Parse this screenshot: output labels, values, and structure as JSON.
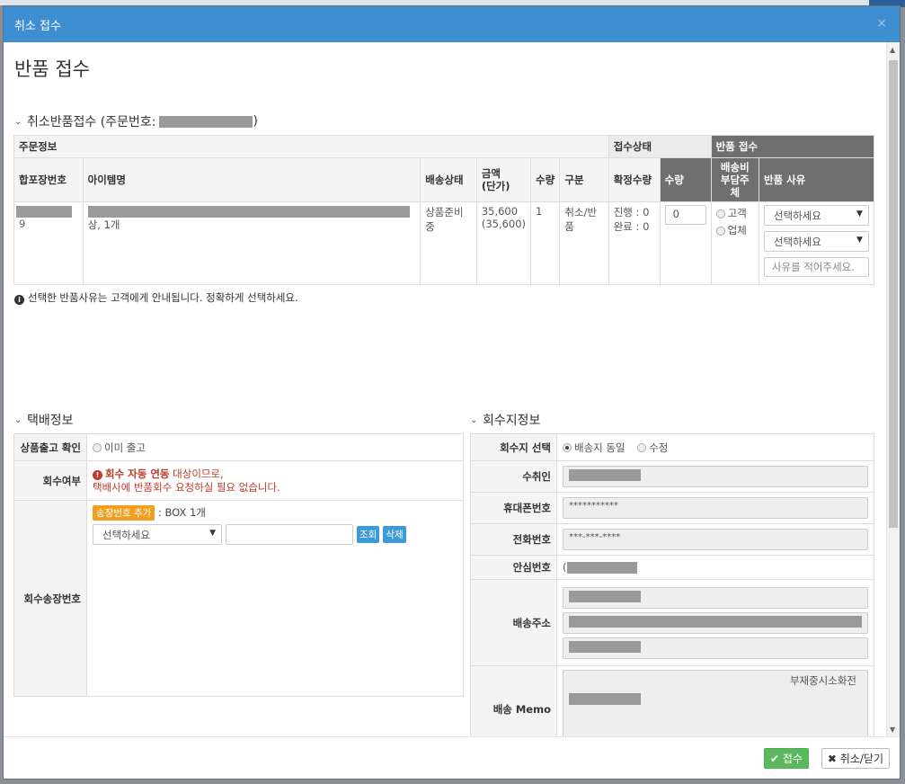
{
  "modal": {
    "title": "취소 접수",
    "close": "×"
  },
  "page_title": "반품 접수",
  "order_section": {
    "title": "취소반품접수 (주문번호:",
    "close_paren": ")"
  },
  "order_table": {
    "group_headers": {
      "order_info": "주문정보",
      "receipt_status": "접수상태",
      "return_receipt": "반품 접수"
    },
    "headers": {
      "pack_no": "합포장번호",
      "item_name": "아이템명",
      "ship_status": "배송상태",
      "amount": "금액\n(단가)",
      "qty": "수량",
      "type": "구분",
      "confirmed_qty": "확정수량",
      "return_qty": "수량",
      "ship_fee_payer": "배송비\n부담주체",
      "return_reason": "반품 사유"
    },
    "row": {
      "pack_no_suffix": "9",
      "item_name_suffix": "상, 1개",
      "ship_status": "상품준비중",
      "amount": "35,600\n(35,600)",
      "qty": "1",
      "type": "취소/반품",
      "confirmed": "진행 : 0\n완료 : 0",
      "return_qty_value": "0",
      "payer_customer": "고객",
      "payer_vendor": "업체",
      "reason_select1": "선택하세요",
      "reason_select2": "선택하세요",
      "reason_placeholder": "사유를 적어주세요."
    }
  },
  "notice": "선택한 반품사유는 고객에게 안내됩니다. 정확하게 선택하세요.",
  "courier": {
    "title": "택배정보",
    "ship_confirm_label": "상품출고 확인",
    "ship_confirm_option": "이미 출고",
    "pickup_label": "회수여부",
    "pickup_msg_bold": "회수 자동 연동",
    "pickup_msg_rest": " 대상이므로,",
    "pickup_msg_line2": "택배사에 반품회수 요청하실 필요 없습니다.",
    "invoice_label": "회수송장번호",
    "add_invoice_btn": "송장번호 추가",
    "box_count": ": BOX 1개",
    "courier_select": "선택하세요",
    "lookup_btn": "조회",
    "delete_btn": "삭제"
  },
  "pickup_info": {
    "title": "회수지정보",
    "location_label": "회수지 선택",
    "option_same": "배송지 동일",
    "option_edit": "수정",
    "recipient_label": "수취인",
    "mobile_label": "휴대폰번호",
    "mobile_value": "***********",
    "phone_label": "전화번호",
    "phone_value": "***-***-****",
    "safe_number_label": "안심번호",
    "safe_number_prefix": "(",
    "address_label": "배송주소",
    "memo_label": "배송 Memo",
    "memo_value": "부재중시소화전"
  },
  "footer": {
    "submit": "접수",
    "cancel": "취소/닫기"
  },
  "colors": {
    "header": "#3d8fd1",
    "submit": "#5cb85c",
    "add_invoice": "#f0a020",
    "button_blue": "#3d9ad8",
    "warning": "#c0392b"
  }
}
